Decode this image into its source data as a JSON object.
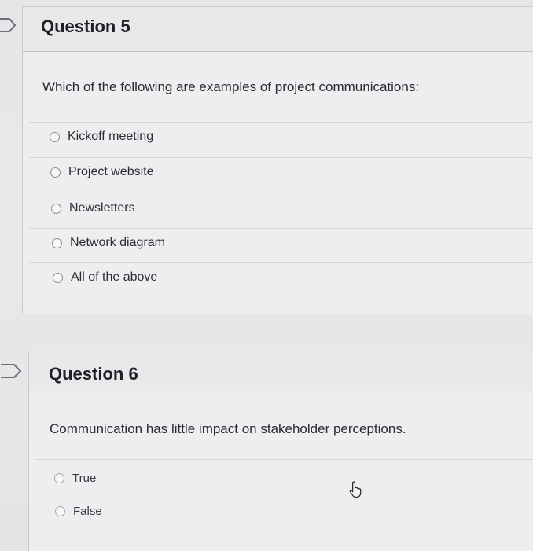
{
  "questions": [
    {
      "title": "Question 5",
      "text": "Which of the following are examples of project communications:",
      "options": [
        "Kickoff meeting",
        "Project website",
        "Newsletters",
        "Network diagram",
        "All of the above"
      ]
    },
    {
      "title": "Question 6",
      "text": "Communication has little impact on stakeholder perceptions.",
      "options": [
        "True",
        "False"
      ]
    }
  ],
  "icons": {
    "flag": "bookmark-flag-icon",
    "cursor": "hand-pointer-icon"
  }
}
